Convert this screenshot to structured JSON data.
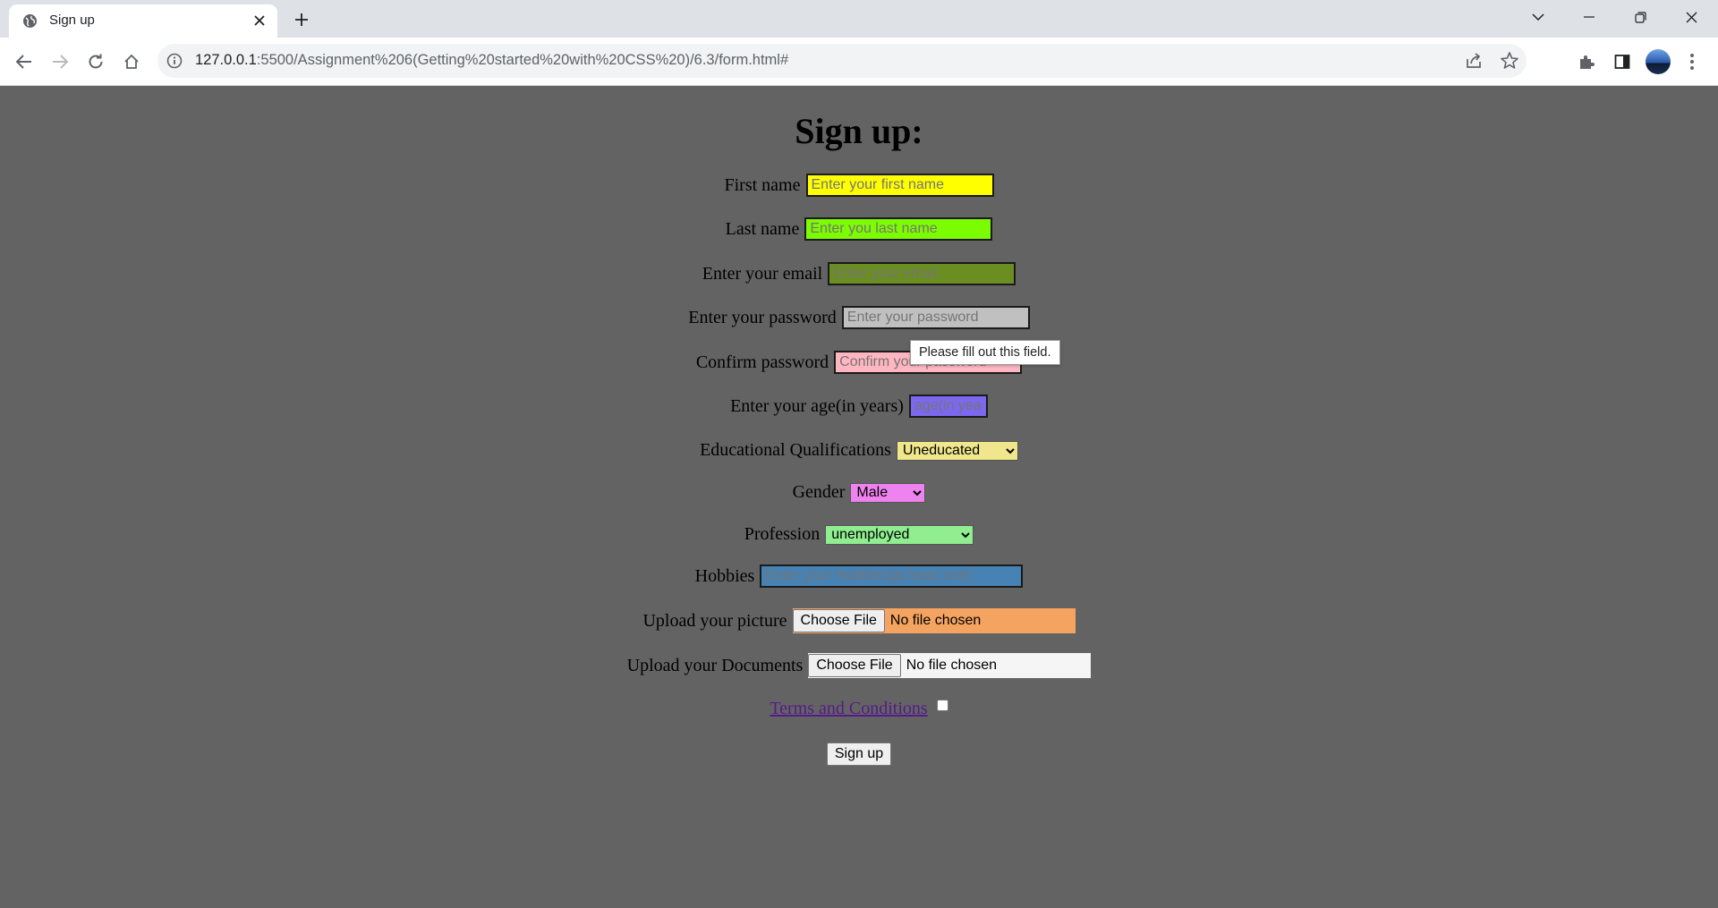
{
  "browser": {
    "tab_title": "Sign up",
    "url_host": "127.0.0.1",
    "url_rest": ":5500/Assignment%206(Getting%20started%20with%20CSS%20)/6.3/form.html#"
  },
  "page": {
    "heading": "Sign up:",
    "first_name": {
      "label": "First name",
      "placeholder": "Enter your first name",
      "color": "#ffff00"
    },
    "last_name": {
      "label": "Last name",
      "placeholder": "Enter you last name",
      "color": "#7cfc00"
    },
    "email": {
      "label": "Enter your email",
      "placeholder": "Enter your email",
      "color": "#6b8e23"
    },
    "password": {
      "label": "Enter your password",
      "placeholder": "Enter your password",
      "color": "#c0c0c0"
    },
    "confirm_password": {
      "label": "Confirm password",
      "placeholder": "Confirm your password",
      "color": "#ffb6c1"
    },
    "age": {
      "label": "Enter your age(in years)",
      "placeholder": "age(in years)",
      "color": "#7b68ee"
    },
    "education": {
      "label": "Educational Qualifications",
      "selected": "Uneducated",
      "color": "#f0e68c"
    },
    "gender": {
      "label": "Gender",
      "selected": "Male",
      "color": "#ee82ee"
    },
    "profession": {
      "label": "Profession",
      "selected": "unemployed",
      "color": "#90ee90"
    },
    "hobbies": {
      "label": "Hobbies",
      "placeholder": "Enter your Hobbies(at least one)",
      "color": "#4682b4"
    },
    "picture": {
      "label": "Upload your picture",
      "button": "Choose File",
      "status": "No file chosen",
      "color": "#f4a460"
    },
    "documents": {
      "label": "Upload your Documents",
      "button": "Choose File",
      "status": "No file chosen",
      "color": "#f5f5f5"
    },
    "terms": {
      "label": "Terms and Conditions"
    },
    "submit_label": "Sign up",
    "tooltip": "Please fill out this field."
  }
}
